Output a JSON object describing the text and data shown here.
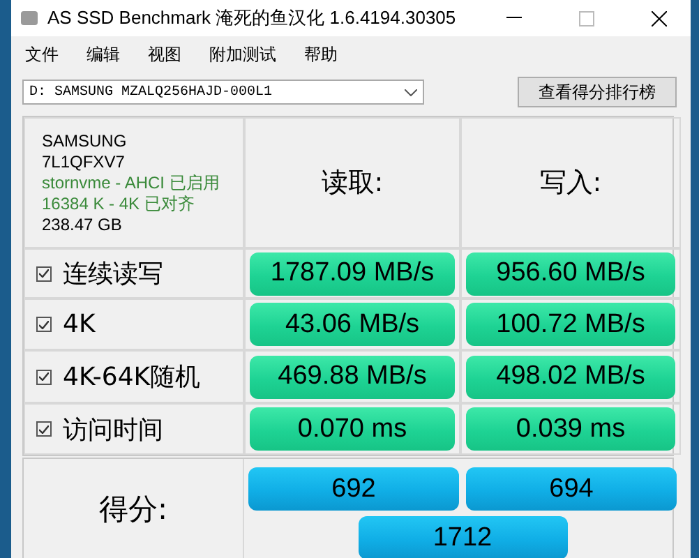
{
  "window": {
    "title": "AS SSD Benchmark 淹死的鱼汉化 1.6.4194.30305"
  },
  "menu": [
    "文件",
    "编辑",
    "视图",
    "附加测试",
    "帮助"
  ],
  "drive_select": {
    "value": "D: SAMSUNG MZALQ256HAJD-000L1"
  },
  "ranking_button": "查看得分排行榜",
  "drive_info": {
    "vendor": "SAMSUNG",
    "firmware": "7L1QFXV7",
    "driver": "stornvme - AHCI 已启用",
    "alignment": "16384 K - 4K 已对齐",
    "capacity": "238.47 GB"
  },
  "columns": [
    "读取:",
    "写入:"
  ],
  "tests": [
    {
      "label": "连续读写",
      "checked": true,
      "read": "1787.09 MB/s",
      "write": "956.60 MB/s"
    },
    {
      "label": "4K",
      "checked": true,
      "read": "43.06 MB/s",
      "write": "100.72 MB/s"
    },
    {
      "label": "4K-64K随机",
      "checked": true,
      "read": "469.88 MB/s",
      "write": "498.02 MB/s"
    },
    {
      "label": "访问时间",
      "checked": true,
      "read": "0.070 ms",
      "write": "0.039 ms"
    }
  ],
  "score": {
    "label": "得分:",
    "read": "692",
    "write": "694",
    "total": "1712"
  }
}
